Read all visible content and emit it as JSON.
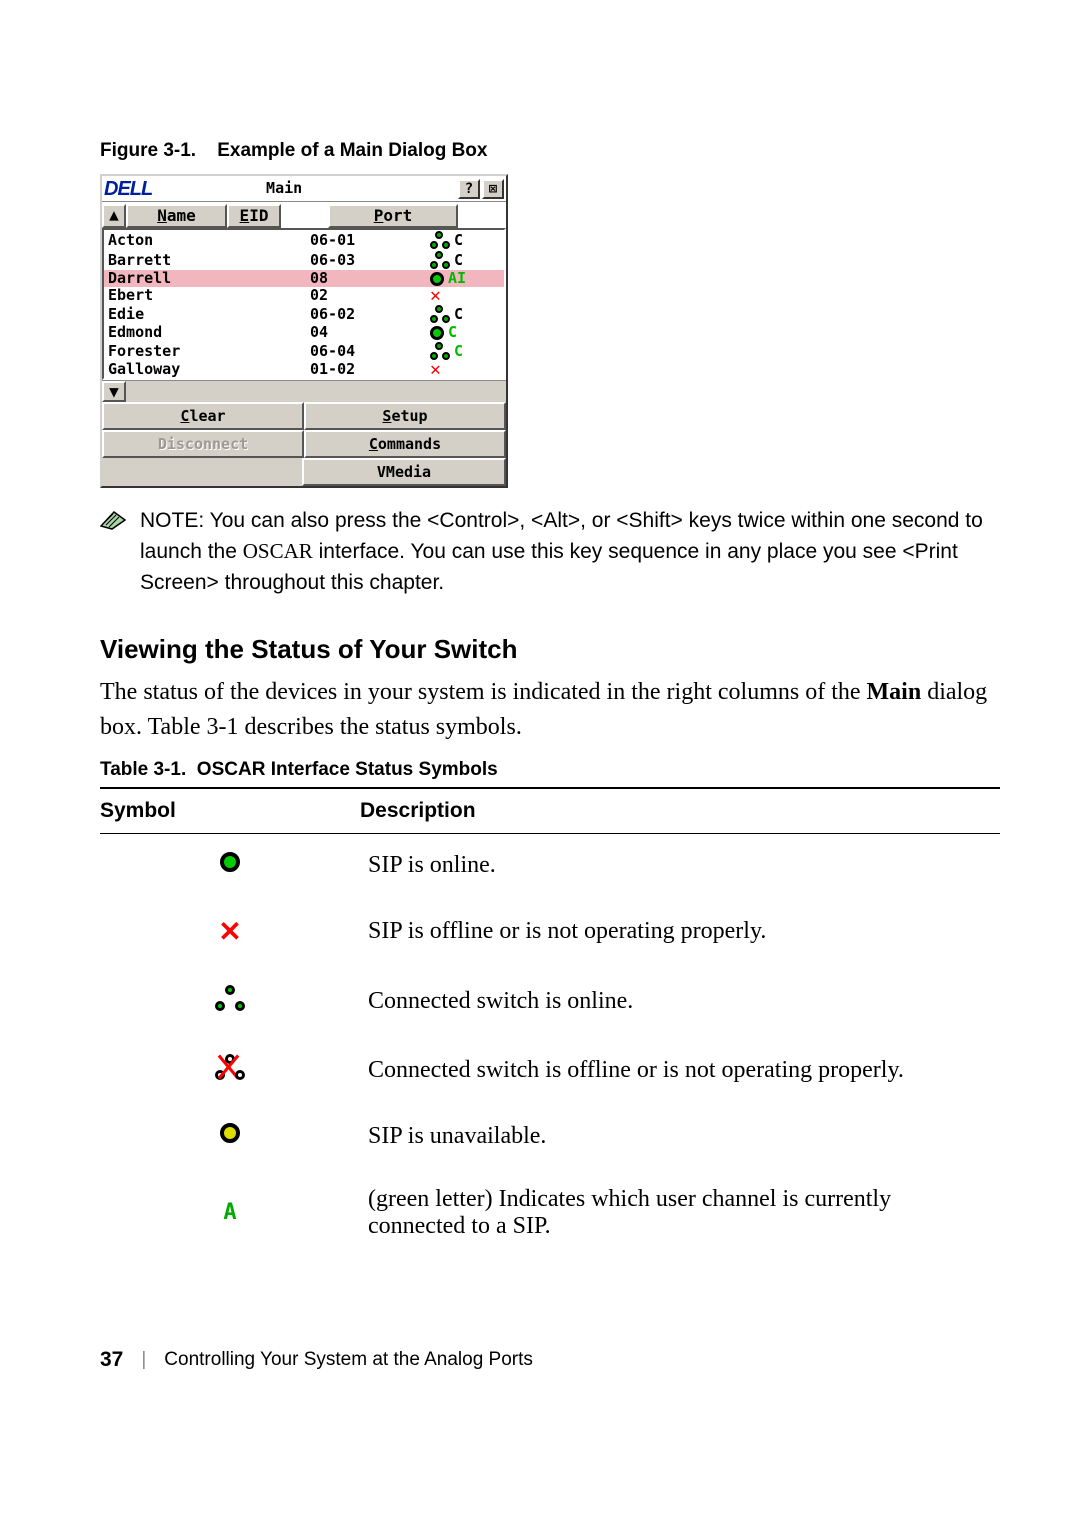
{
  "figure": {
    "label": "Figure 3-1.",
    "caption": "Example of a Main Dialog Box"
  },
  "dialog": {
    "logo": "DELL",
    "title": "Main",
    "help_btn": "?",
    "close_btn": "⊠",
    "headers": {
      "name": "Name",
      "name_key": "N",
      "eid": "EID",
      "eid_key": "E",
      "port": "Port",
      "port_key": "P"
    },
    "scroll_up": "▲",
    "scroll_down": "▼",
    "rows": [
      {
        "name": "Acton",
        "port": "06-01",
        "status": "switch",
        "chan": "C",
        "chan_color": "black",
        "selected": false
      },
      {
        "name": "Barrett",
        "port": "06-03",
        "status": "switch",
        "chan": "C",
        "chan_color": "black",
        "selected": false
      },
      {
        "name": "Darrell",
        "port": "08",
        "status": "online",
        "chan": "AI",
        "chan_color": "green",
        "selected": true
      },
      {
        "name": "Ebert",
        "port": "02",
        "status": "offline",
        "chan": "",
        "chan_color": "",
        "selected": false
      },
      {
        "name": "Edie",
        "port": "06-02",
        "status": "switch",
        "chan": "C",
        "chan_color": "black",
        "selected": false
      },
      {
        "name": "Edmond",
        "port": "04",
        "status": "online",
        "chan": "C",
        "chan_color": "green",
        "selected": false
      },
      {
        "name": "Forester",
        "port": "06-04",
        "status": "switch",
        "chan": "C",
        "chan_color": "green",
        "selected": false
      },
      {
        "name": "Galloway",
        "port": "01-02",
        "status": "offline",
        "chan": "",
        "chan_color": "",
        "selected": false
      }
    ],
    "buttons": {
      "clear": {
        "label": "Clear",
        "ul_prefix": "C",
        "ul_rest": "lear",
        "enabled": true
      },
      "setup": {
        "label": "Setup",
        "ul_prefix": "S",
        "ul_rest": "etup",
        "enabled": true
      },
      "disconnect": {
        "label": "Disconnect",
        "ul_prefix": "D",
        "ul_rest": "isconnect",
        "enabled": false
      },
      "commands": {
        "label": "Commands",
        "ul_prefix": "C",
        "ul_rest": "ommands",
        "enabled": true
      },
      "vmedia": {
        "label": "VMedia",
        "ul_prefix": "",
        "ul_rest": "VMedia",
        "enabled": true
      }
    }
  },
  "note": {
    "label": "NOTE:",
    "text_1": "  You can also press the <Control>, <Alt>, or <Shift> keys twice within one second to launch the ",
    "oscar": "OSCAR",
    "text_2": " interface. You can use this key sequence in any place you see <Print Screen> throughout this chapter."
  },
  "section": {
    "heading": "Viewing the Status of Your Switch",
    "body_1": "The status of the devices in your system is indicated in the right columns of the ",
    "main_bold": "Main",
    "body_2": " dialog box. Table 3-1 describes the status symbols."
  },
  "table": {
    "label": "Table 3-1.",
    "caption": "OSCAR Interface Status Symbols",
    "headers": {
      "symbol": "Symbol",
      "description": "Description"
    },
    "rows": [
      {
        "icon": "circle-green",
        "desc": "SIP is online."
      },
      {
        "icon": "red-x",
        "desc": "SIP is offline or is not operating properly."
      },
      {
        "icon": "switch-online",
        "desc": "Connected switch is online."
      },
      {
        "icon": "switch-offline",
        "desc": "Connected switch is offline or is not operating properly."
      },
      {
        "icon": "circle-yellow",
        "desc": "SIP is unavailable."
      },
      {
        "icon": "letter-a",
        "desc": "(green letter) Indicates which user channel is currently connected to a SIP."
      }
    ]
  },
  "footer": {
    "page": "37",
    "chapter": "Controlling Your System at the Analog Ports"
  }
}
